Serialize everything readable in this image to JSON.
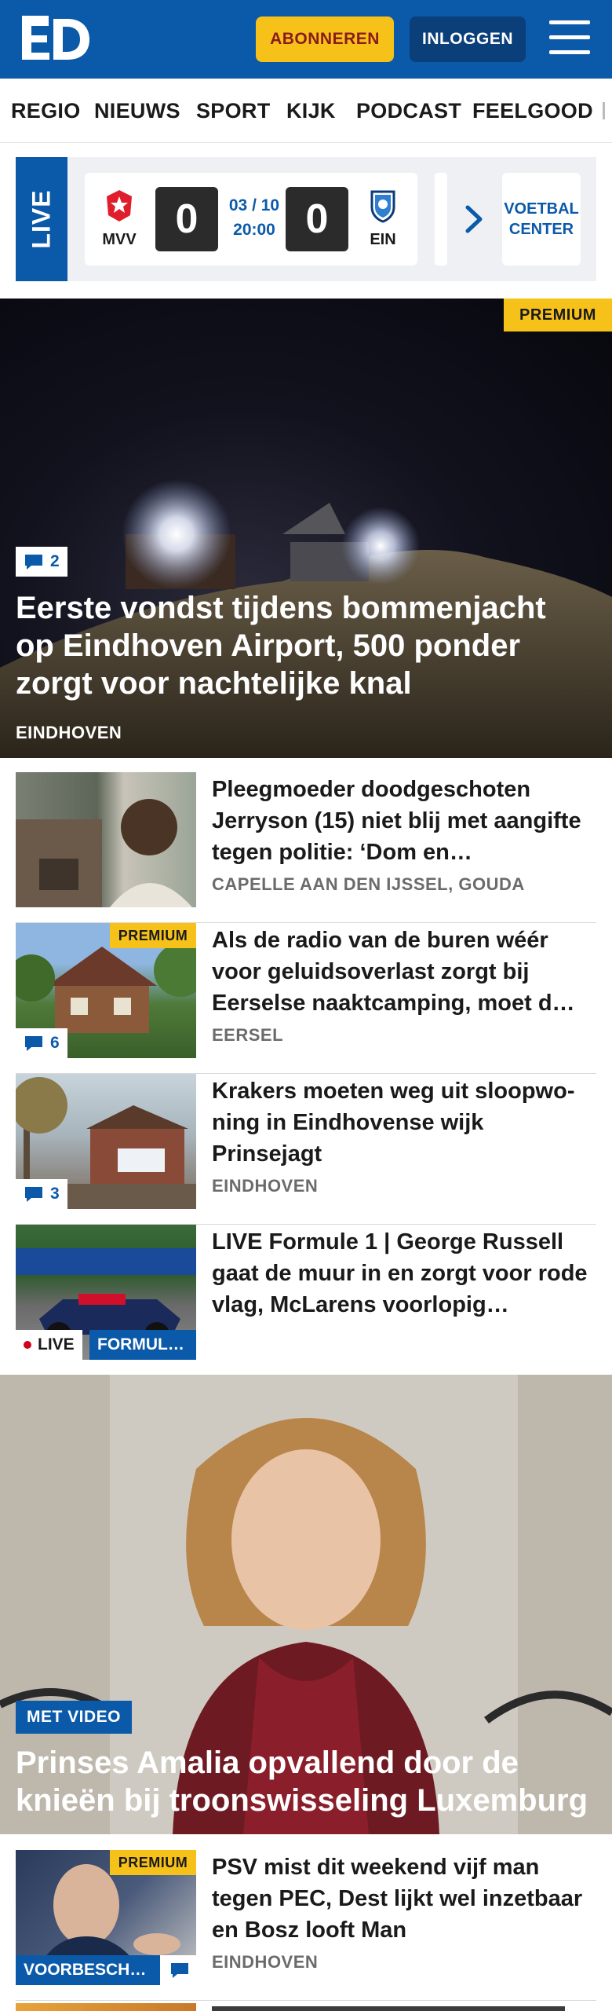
{
  "header": {
    "logo_text": "ED",
    "subscribe_label": "ABONNEREN",
    "login_label": "INLOGGEN",
    "menu_icon": "hamburger-icon",
    "brand_color": "#0b5aa9",
    "accent_color": "#f6c21a"
  },
  "nav": {
    "items": [
      "REGIO",
      "NIEUWS",
      "SPORT",
      "KIJK",
      "PODCAST",
      "FEELGOOD"
    ]
  },
  "live_scores": {
    "tab_label": "LIVE",
    "match": {
      "home_team": "MVV",
      "away_team": "EIN",
      "home_score": "0",
      "away_score": "0",
      "date": "03 / 10",
      "time": "20:00"
    },
    "voetbal_center_label": "VOETBAL CENTER"
  },
  "hero": {
    "premium_label": "PREMIUM",
    "comment_count": "2",
    "title": "Eerste vondst tijdens bommenjacht op Eindhoven Airport, 500 ponder zorgt voor nachtelijke knal",
    "location": "EINDHOVEN"
  },
  "articles": [
    {
      "title": "Pleegmoeder doodgeschoten Jerryson (15) niet blij met aangifte tegen politie: ‘Dom en…",
      "location": "CAPELLE AAN DEN IJSSEL, GOUDA"
    },
    {
      "premium_label": "PREMIUM",
      "comment_count": "6",
      "title": "Als de radio van de buren wéér voor geluidsoverlast zorgt bij Eerselse naaktcamping, moet d…",
      "location": "EERSEL"
    },
    {
      "comment_count": "3",
      "title": "Krakers moeten weg uit sloopwo­ning in Eindhovense wijk Prinsejagt",
      "location": "EINDHOVEN"
    },
    {
      "live_label": "LIVE",
      "category_label": "FORMUL…",
      "title": "LIVE Formule 1 | George Russell gaat de muur in en zorgt voor rode vlag, McLarens voorlopig…",
      "location": ""
    }
  ],
  "hero2": {
    "video_label": "MET VIDEO",
    "title": "Prinses Amalia opvallend door de knieën bij troonswisseling Luxemburg"
  },
  "article_psv": {
    "premium_label": "PREMIUM",
    "category_label": "VOORBESCH…",
    "title": "PSV mist dit weekend vijf man tegen PEC, Dest lijkt wel inzetbaar en Bosz looft Man",
    "location": "EINDHOVEN"
  }
}
